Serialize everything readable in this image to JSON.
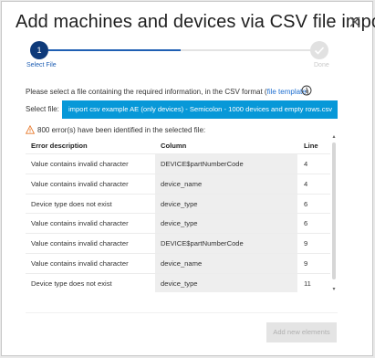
{
  "dialog": {
    "title": "Add machines and devices via CSV file import",
    "close_icon": "close-icon"
  },
  "stepper": {
    "steps": [
      {
        "number": "1",
        "label": "Select File",
        "state": "active"
      },
      {
        "number": "",
        "label": "Done",
        "state": "pending"
      }
    ],
    "active_color": "#0e3a7a",
    "progress_color": "#1f5fb3"
  },
  "instruction": {
    "text_before": "Please select a file containing the required information, in the CSV format (",
    "link_text": "file template",
    "text_after": ").",
    "info_icon": "info-icon"
  },
  "file_select": {
    "label": "Select file:",
    "value": "import csv example AE (only devices) - Semicolon - 1000 devices and empty rows.csv",
    "color": "#0798d8"
  },
  "warning": {
    "icon": "warning-icon",
    "text": "800 error(s) have been identified in the selected file:",
    "color": "#e8792b"
  },
  "table": {
    "headers": {
      "error": "Error description",
      "column": "Column",
      "line": "Line"
    },
    "rows": [
      {
        "error": "Value contains invalid character",
        "column": "DEVICE$partNumberCode",
        "line": "4"
      },
      {
        "error": "Value contains invalid character",
        "column": "device_name",
        "line": "4"
      },
      {
        "error": "Device type does not exist",
        "column": "device_type",
        "line": "6"
      },
      {
        "error": "Value contains invalid character",
        "column": "device_type",
        "line": "6"
      },
      {
        "error": "Value contains invalid character",
        "column": "DEVICE$partNumberCode",
        "line": "9"
      },
      {
        "error": "Value contains invalid character",
        "column": "device_name",
        "line": "9"
      },
      {
        "error": "Device type does not exist",
        "column": "device_type",
        "line": "11"
      },
      {
        "error": "",
        "column": "",
        "line": ""
      }
    ]
  },
  "footer": {
    "add_button_label": "Add new elements"
  }
}
